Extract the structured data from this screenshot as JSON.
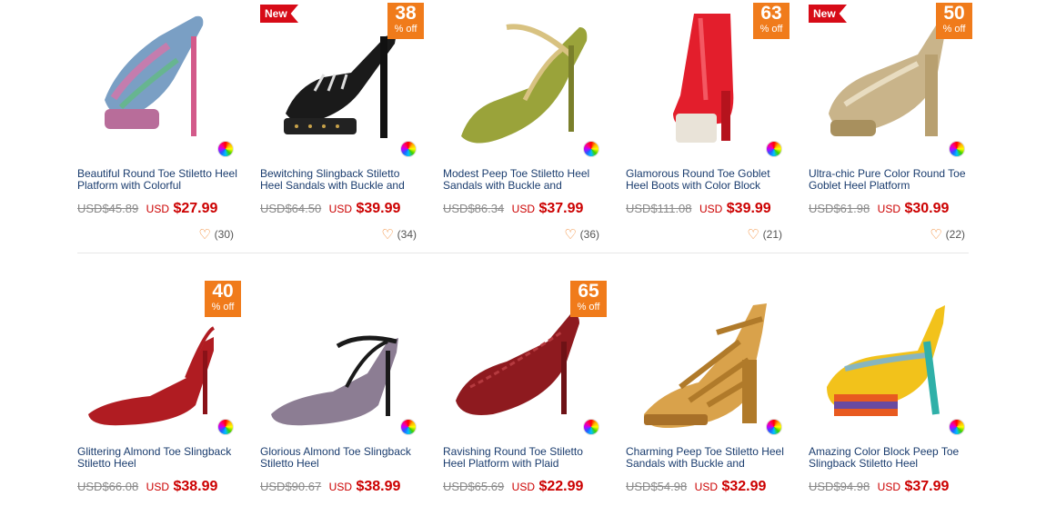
{
  "currency": "USD",
  "products": [
    {
      "name": "Beautiful Round Toe Stiletto Heel Platform with Colorful",
      "old_price": "USD$45.89",
      "currency_label": "USD",
      "price": "$27.99",
      "favorites": "(30)",
      "badge_new": "",
      "discount_pct": "",
      "discount_label": "",
      "color_swatch_icon": "color-wheel-icon",
      "shoe_color": "#7a9fc4"
    },
    {
      "name": "Bewitching Slingback Stiletto Heel Sandals with Buckle and",
      "old_price": "USD$64.50",
      "currency_label": "USD",
      "price": "$39.99",
      "favorites": "(34)",
      "badge_new": "New",
      "discount_pct": "38",
      "discount_label": "% off",
      "color_swatch_icon": "color-wheel-icon",
      "shoe_color": "#1a1a1a"
    },
    {
      "name": "Modest Peep Toe Stiletto Heel Sandals with Buckle and",
      "old_price": "USD$86.34",
      "currency_label": "USD",
      "price": "$37.99",
      "favorites": "(36)",
      "badge_new": "",
      "discount_pct": "",
      "discount_label": "",
      "color_swatch_icon": "color-wheel-icon",
      "shoe_color": "#9aa33a"
    },
    {
      "name": "Glamorous Round Toe Goblet Heel Boots with Color Block",
      "old_price": "USD$111.08",
      "currency_label": "USD",
      "price": "$39.99",
      "favorites": "(21)",
      "badge_new": "",
      "discount_pct": "63",
      "discount_label": "% off",
      "color_swatch_icon": "color-wheel-icon",
      "shoe_color": "#e31e2c"
    },
    {
      "name": "Ultra-chic Pure Color Round Toe Goblet Heel Platform",
      "old_price": "USD$61.98",
      "currency_label": "USD",
      "price": "$30.99",
      "favorites": "(22)",
      "badge_new": "New",
      "discount_pct": "50",
      "discount_label": "% off",
      "color_swatch_icon": "color-wheel-icon",
      "shoe_color": "#c9b48a"
    },
    {
      "name": "Glittering Almond Toe Slingback Stiletto Heel",
      "old_price": "USD$66.08",
      "currency_label": "USD",
      "price": "$38.99",
      "favorites": "",
      "badge_new": "",
      "discount_pct": "40",
      "discount_label": "% off",
      "color_swatch_icon": "color-wheel-icon",
      "shoe_color": "#b01c22"
    },
    {
      "name": "Glorious Almond Toe Slingback Stiletto Heel",
      "old_price": "USD$90.67",
      "currency_label": "USD",
      "price": "$38.99",
      "favorites": "",
      "badge_new": "",
      "discount_pct": "",
      "discount_label": "",
      "color_swatch_icon": "color-wheel-icon",
      "shoe_color": "#8c7d93"
    },
    {
      "name": "Ravishing Round Toe Stiletto Heel Platform with Plaid",
      "old_price": "USD$65.69",
      "currency_label": "USD",
      "price": "$22.99",
      "favorites": "",
      "badge_new": "",
      "discount_pct": "65",
      "discount_label": "% off",
      "color_swatch_icon": "color-wheel-icon",
      "shoe_color": "#8e1a1f"
    },
    {
      "name": "Charming Peep Toe Stiletto Heel Sandals with Buckle and",
      "old_price": "USD$54.98",
      "currency_label": "USD",
      "price": "$32.99",
      "favorites": "",
      "badge_new": "",
      "discount_pct": "",
      "discount_label": "",
      "color_swatch_icon": "color-wheel-icon",
      "shoe_color": "#d9a24b"
    },
    {
      "name": "Amazing Color Block Peep Toe Slingback Stiletto Heel",
      "old_price": "USD$94.98",
      "currency_label": "USD",
      "price": "$37.99",
      "favorites": "",
      "badge_new": "",
      "discount_pct": "",
      "discount_label": "",
      "color_swatch_icon": "color-wheel-icon",
      "shoe_color": "#f2c21b"
    }
  ]
}
